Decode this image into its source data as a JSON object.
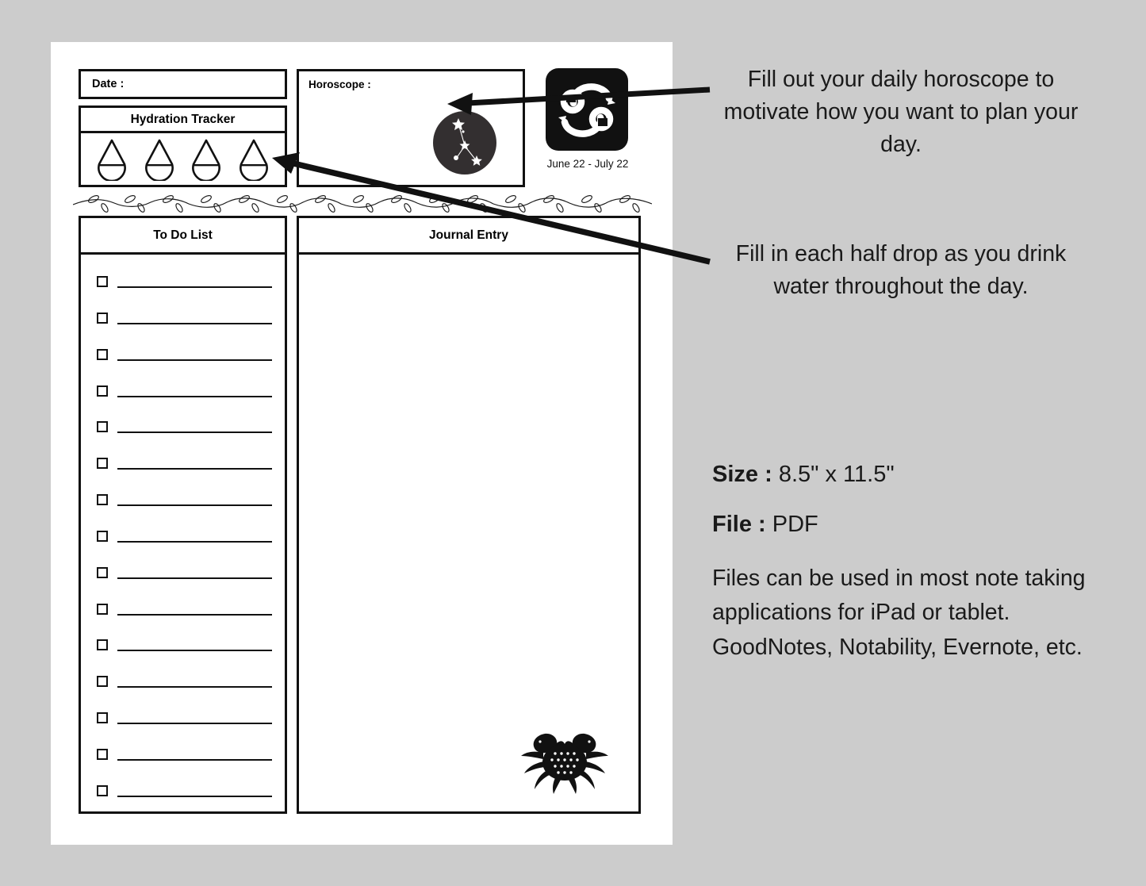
{
  "background_color": "#cccccc",
  "page": {
    "date_field": {
      "label": "Date :"
    },
    "hydration": {
      "title": "Hydration Tracker",
      "drop_count": 4,
      "drop_icon": "water-drop-icon"
    },
    "horoscope": {
      "label": "Horoscope :",
      "constellation_icon": "cancer-constellation-icon"
    },
    "zodiac": {
      "sign": "Cancer",
      "glyph_icon": "cancer-zodiac-glyph-icon",
      "dates": "June 22 - July 22"
    },
    "divider": {
      "icon": "leafy-vine-divider-icon"
    },
    "todo": {
      "title": "To Do List",
      "row_count": 15,
      "rows": [
        "",
        "",
        "",
        "",
        "",
        "",
        "",
        "",
        "",
        "",
        "",
        "",
        "",
        "",
        ""
      ]
    },
    "journal": {
      "title": "Journal Entry",
      "body": "",
      "crab_icon": "crab-silhouette-icon"
    }
  },
  "annotations": {
    "horoscope_note": "Fill out your daily horoscope to motivate how you want to plan your day.",
    "hydration_note": "Fill in each half drop as you drink water throughout the day.",
    "arrow_1": "arrow-to-horoscope-box",
    "arrow_2": "arrow-to-hydration-drop"
  },
  "specs": {
    "size_label": "Size :",
    "size_value": "8.5\" x 11.5\"",
    "file_label": "File :",
    "file_value": "PDF",
    "description": "Files can be used in most note taking applications for iPad or tablet. GoodNotes, Notability, Evernote, etc."
  }
}
